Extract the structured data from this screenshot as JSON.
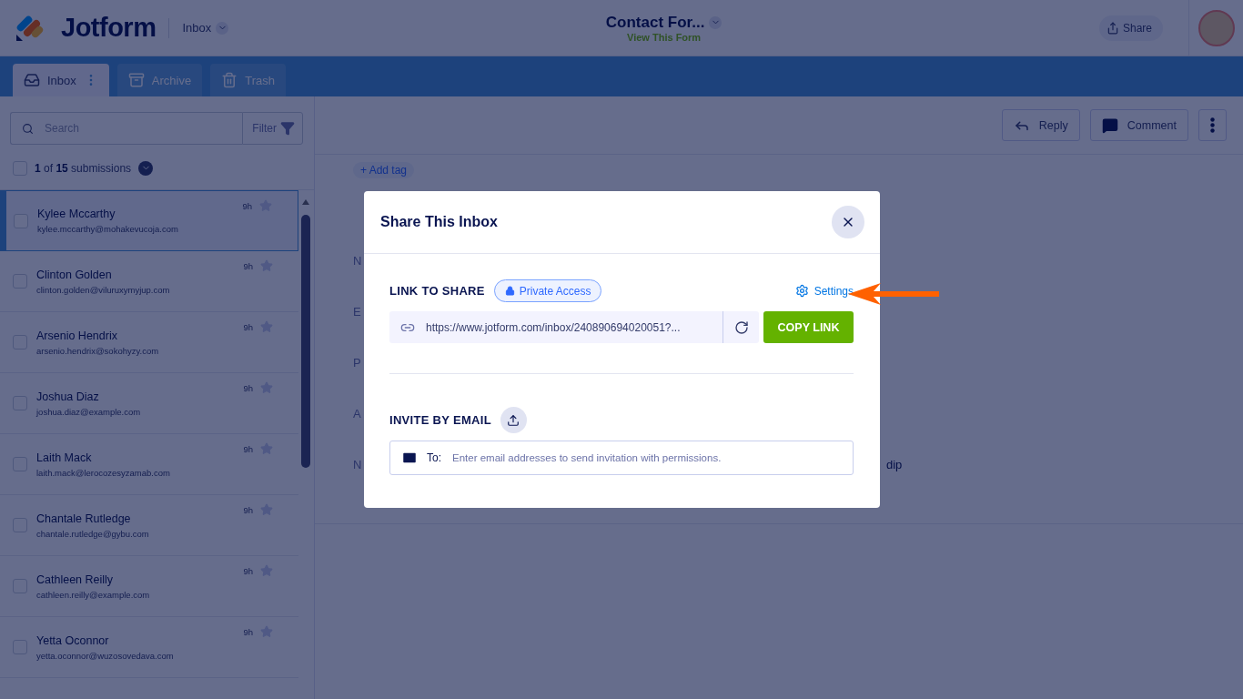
{
  "header": {
    "brand": "Jotform",
    "section": "Inbox",
    "form_title": "Contact For...",
    "form_link": "View This Form",
    "share_button": "Share"
  },
  "tabs": [
    {
      "label": "Inbox",
      "selected": true,
      "kind": "inbox"
    },
    {
      "label": "Archive",
      "selected": false,
      "kind": "archive"
    },
    {
      "label": "Trash",
      "selected": false,
      "kind": "trash"
    }
  ],
  "sidebar": {
    "search": {
      "placeholder": "Search"
    },
    "filter_button": "Filter",
    "select_all": {
      "checked": false
    },
    "count": "**1** of **15** submissions",
    "submissions": [
      {
        "name": "Kylee Mccarthy",
        "email": "kylee.mccarthy@mohakevucoja.com",
        "time": "9h",
        "selected": true,
        "checked": false
      },
      {
        "name": "Clinton Golden",
        "email": "clinton.golden@viluruxymyjup.com",
        "time": "9h",
        "selected": false,
        "checked": false
      },
      {
        "name": "Arsenio Hendrix",
        "email": "arsenio.hendrix@sokohyzy.com",
        "time": "9h",
        "selected": false,
        "checked": false
      },
      {
        "name": "Joshua Diaz",
        "email": "joshua.diaz@example.com",
        "time": "9h",
        "selected": false,
        "checked": false
      },
      {
        "name": "Laith Mack",
        "email": "laith.mack@lerocozesyzamab.com",
        "time": "9h",
        "selected": false,
        "checked": false
      },
      {
        "name": "Chantale Rutledge",
        "email": "chantale.rutledge@gybu.com",
        "time": "9h",
        "selected": false,
        "checked": false
      },
      {
        "name": "Cathleen Reilly",
        "email": "cathleen.reilly@example.com",
        "time": "9h",
        "selected": false,
        "checked": false
      },
      {
        "name": "Yetta Oconnor",
        "email": "yetta.oconnor@wuzosovedava.com",
        "time": "9h",
        "selected": false,
        "checked": false
      }
    ]
  },
  "detail": {
    "toolbar": [
      "Reply",
      "Comment"
    ],
    "add_tag": "+ Add tag",
    "fields": [
      {
        "label": "N"
      },
      {
        "label": "E"
      },
      {
        "label": "P"
      },
      {
        "label": "A"
      },
      {
        "label": "N",
        "value": "dip"
      }
    ]
  },
  "dialog": {
    "title": "Share This Inbox",
    "link_section": "LINK TO SHARE",
    "access_badge": "Private Access",
    "settings_link": "Settings",
    "link_url": "https://www.jotform.com/inbox/240890694020051?...",
    "copy_button": "COPY LINK",
    "invite_section": "INVITE BY EMAIL",
    "to_label": "To:",
    "email_placeholder": "Enter email addresses to send invitation with permissions."
  }
}
